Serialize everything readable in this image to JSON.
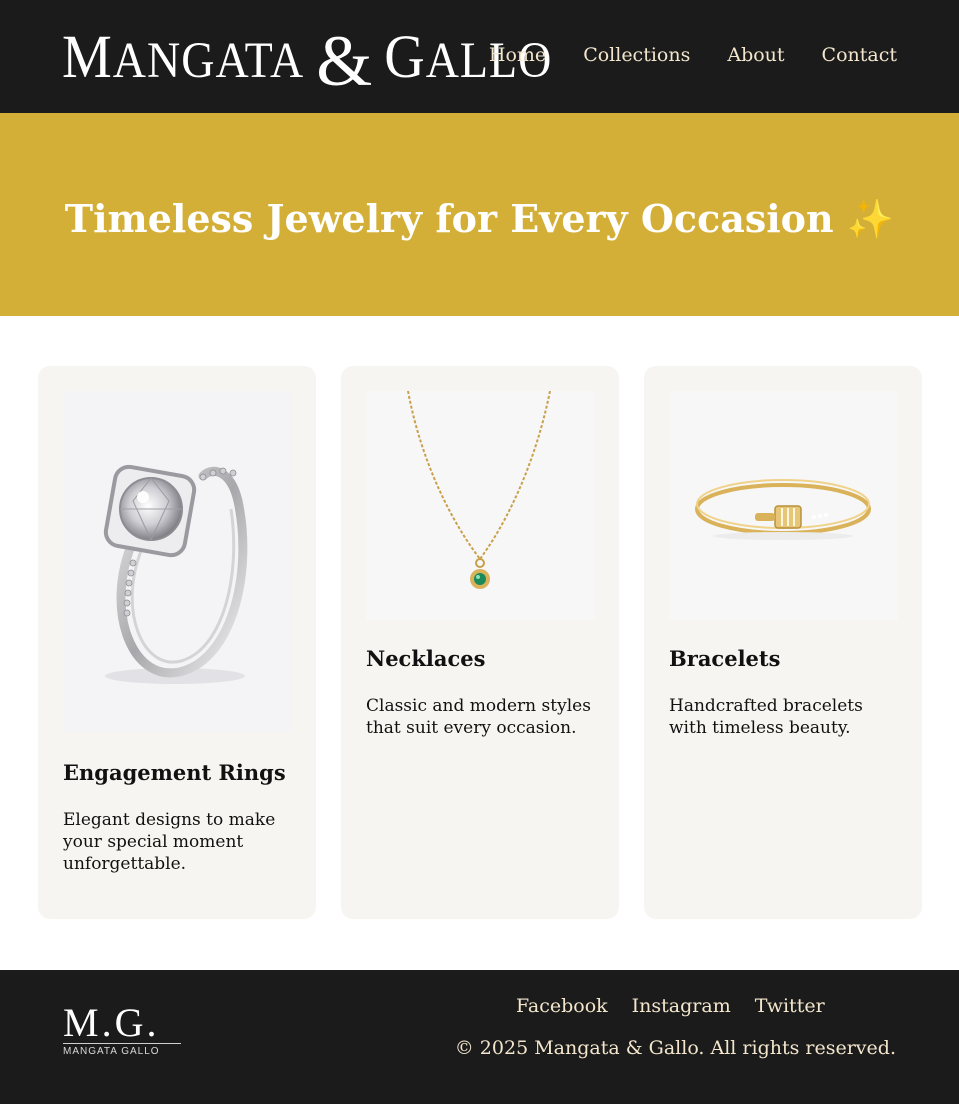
{
  "header": {
    "brand": {
      "word1_cap": "M",
      "word1_rest": "ANGATA",
      "amp": "&",
      "word2_cap": "G",
      "word2_rest": "ALLO"
    },
    "nav": [
      "Home",
      "Collections",
      "About",
      "Contact"
    ]
  },
  "hero": {
    "title": "Timeless Jewelry for Every Occasion",
    "emoji": "✨"
  },
  "cards": [
    {
      "title": "Engagement Rings",
      "description": "Elegant designs to make your special moment unforgettable.",
      "image": "silver-halo-ring-image"
    },
    {
      "title": "Necklaces",
      "description": "Classic and modern styles that suit every occasion.",
      "image": "gold-emerald-pendant-necklace-image"
    },
    {
      "title": "Bracelets",
      "description": "Handcrafted bracelets with timeless beauty.",
      "image": "gold-bangle-bracelet-image"
    }
  ],
  "footer": {
    "logo": {
      "initials": "M.G.",
      "subtitle": "MANGATA GALLO"
    },
    "social": [
      "Facebook",
      "Instagram",
      "Twitter"
    ],
    "copyright": "© 2025 Mangata & Gallo. All rights reserved."
  },
  "colors": {
    "header_bg": "#1b1b1b",
    "hero_bg": "#d4af37",
    "card_bg": "#f7f5f1",
    "nav_text": "#f3e6cc"
  }
}
